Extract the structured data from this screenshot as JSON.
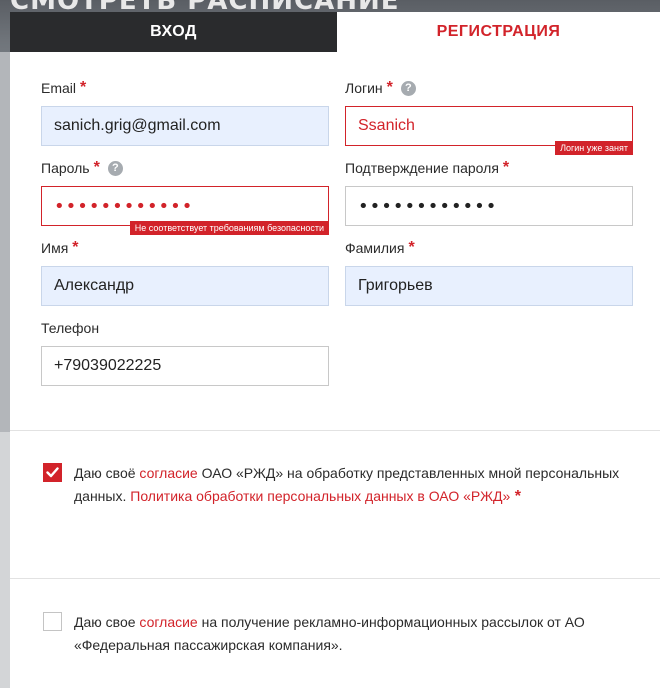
{
  "background": {
    "banner_text": "СМОТРЕТЬ РАСПИСАНИЕ"
  },
  "tabs": {
    "login": "ВХОД",
    "register": "РЕГИСТРАЦИЯ"
  },
  "form": {
    "email": {
      "label": "Email",
      "value": "sanich.grig@gmail.com"
    },
    "login": {
      "label": "Логин",
      "value": "Ssanich",
      "error": "Логин уже занят"
    },
    "password": {
      "label": "Пароль",
      "value": "••••••••••••",
      "error": "Не соответствует требованиям безопасности"
    },
    "password_confirm": {
      "label": "Подтверждение пароля",
      "value": "••••••••••••"
    },
    "first_name": {
      "label": "Имя",
      "value": "Александр"
    },
    "last_name": {
      "label": "Фамилия",
      "value": "Григорьев"
    },
    "phone": {
      "label": "Телефон",
      "value": "+79039022225"
    },
    "required_mark": "*",
    "help_mark": "?"
  },
  "consents": {
    "personal_data": {
      "checked": true,
      "text_1": "Даю своё ",
      "link_1": "согласие",
      "text_2": " ОАО «РЖД» на обработку представленных мной персональных данных. ",
      "link_2": "Политика обработки персональных данных в ОАО «РЖД»",
      "required_mark": " *"
    },
    "marketing": {
      "checked": false,
      "text_1": "Даю свое ",
      "link_1": "согласие",
      "text_2": " на получение рекламно-информационных рассылок от АО «Федеральная пассажирская компания»."
    }
  },
  "colors": {
    "accent": "#d2232a",
    "tab_dark": "#2a2b2d",
    "autofill_bg": "#e8f0fe"
  }
}
